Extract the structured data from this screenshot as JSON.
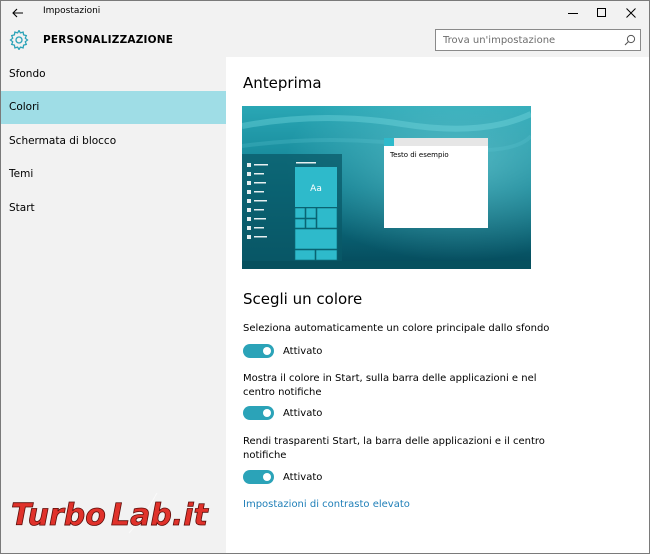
{
  "titlebar": {
    "title": "Impostazioni"
  },
  "header": {
    "section": "PERSONALIZZAZIONE",
    "search_placeholder": "Trova un'impostazione"
  },
  "sidebar": {
    "items": [
      {
        "label": "Sfondo"
      },
      {
        "label": "Colori"
      },
      {
        "label": "Schermata di blocco"
      },
      {
        "label": "Temi"
      },
      {
        "label": "Start"
      }
    ],
    "active_index": 1
  },
  "main": {
    "preview_title": "Anteprima",
    "preview_window_text": "Testo di esempio",
    "preview_tile_text": "Aa",
    "color_title": "Scegli un colore",
    "options": [
      {
        "label": "Seleziona automaticamente un colore principale dallo sfondo",
        "state": "Attivato"
      },
      {
        "label": "Mostra il colore in Start, sulla barra delle applicazioni e nel centro notifiche",
        "state": "Attivato"
      },
      {
        "label": "Rendi trasparenti Start, la barra delle applicazioni e il centro notifiche",
        "state": "Attivato"
      }
    ],
    "contrast_link": "Impostazioni di contrasto elevato"
  },
  "colors": {
    "accent": "#2ba3b8",
    "active_nav": "#9fdde6",
    "chrome": "#f2f2f2",
    "link": "#1f7fb8"
  },
  "watermark": {
    "text_a": "Turbo",
    "text_b": "Lab.it"
  }
}
